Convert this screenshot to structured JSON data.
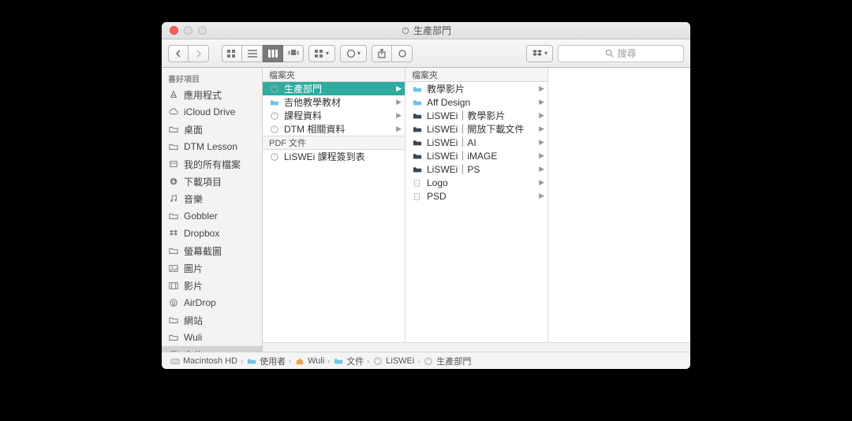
{
  "window_title": "生產部門",
  "toolbar": {
    "back": "‹",
    "forward": "›"
  },
  "search": {
    "placeholder": "搜尋"
  },
  "sidebar": {
    "header": "喜好項目",
    "items": [
      {
        "label": "應用程式",
        "icon": "apps"
      },
      {
        "label": "iCloud Drive",
        "icon": "cloud"
      },
      {
        "label": "桌面",
        "icon": "folder"
      },
      {
        "label": "DTM Lesson",
        "icon": "folder"
      },
      {
        "label": "我的所有檔案",
        "icon": "allfiles"
      },
      {
        "label": "下載項目",
        "icon": "download"
      },
      {
        "label": "音樂",
        "icon": "music"
      },
      {
        "label": "Gobbler",
        "icon": "folder"
      },
      {
        "label": "Dropbox",
        "icon": "dropbox"
      },
      {
        "label": "螢幕截圖",
        "icon": "folder"
      },
      {
        "label": "圖片",
        "icon": "photos"
      },
      {
        "label": "影片",
        "icon": "movies"
      },
      {
        "label": "AirDrop",
        "icon": "airdrop"
      },
      {
        "label": "網站",
        "icon": "folder"
      },
      {
        "label": "Wuli",
        "icon": "folder"
      },
      {
        "label": "文件",
        "icon": "documents"
      }
    ],
    "active_index": 15
  },
  "columns": [
    {
      "header": "檔案夾",
      "groups": [
        {
          "header": null,
          "items": [
            {
              "label": "生產部門",
              "icon": "tagfolder",
              "arrow": true,
              "selected": true
            },
            {
              "label": "吉他教學教材",
              "icon": "bluefolder",
              "arrow": true
            },
            {
              "label": "課程資料",
              "icon": "tagfolder",
              "arrow": true
            },
            {
              "label": "DTM 相關資料",
              "icon": "tagfolder",
              "arrow": true
            }
          ]
        },
        {
          "header": "PDF 文件",
          "items": [
            {
              "label": "LiSWEi 課程簽到表",
              "icon": "tagfolder"
            }
          ]
        }
      ]
    },
    {
      "header": "檔案夾",
      "groups": [
        {
          "header": null,
          "items": [
            {
              "label": "教學影片",
              "icon": "bluefolder",
              "arrow": true
            },
            {
              "label": "Aff Design",
              "icon": "bluefolder",
              "arrow": true
            },
            {
              "label": "LiSWEi｜教學影片",
              "icon": "darkfolder",
              "arrow": true
            },
            {
              "label": "LiSWEi｜開放下載文件",
              "icon": "darkfolder",
              "arrow": true
            },
            {
              "label": "LiSWEi｜AI",
              "icon": "darkfolder",
              "arrow": true
            },
            {
              "label": "LiSWEi｜iMAGE",
              "icon": "darkfolder",
              "arrow": true
            },
            {
              "label": "LiSWEi｜PS",
              "icon": "darkfolder",
              "arrow": true
            },
            {
              "label": "Logo",
              "icon": "tagfile",
              "arrow": true
            },
            {
              "label": "PSD",
              "icon": "tagfile",
              "arrow": true
            }
          ]
        }
      ]
    },
    {
      "header": "",
      "groups": []
    }
  ],
  "pathbar": [
    {
      "label": "Macintosh HD",
      "icon": "hd"
    },
    {
      "label": "使用者",
      "icon": "bluefolder"
    },
    {
      "label": "Wuli",
      "icon": "home"
    },
    {
      "label": "文件",
      "icon": "bluefolder"
    },
    {
      "label": "LiSWEi",
      "icon": "tagfolder"
    },
    {
      "label": "生產部門",
      "icon": "tagfolder"
    }
  ]
}
